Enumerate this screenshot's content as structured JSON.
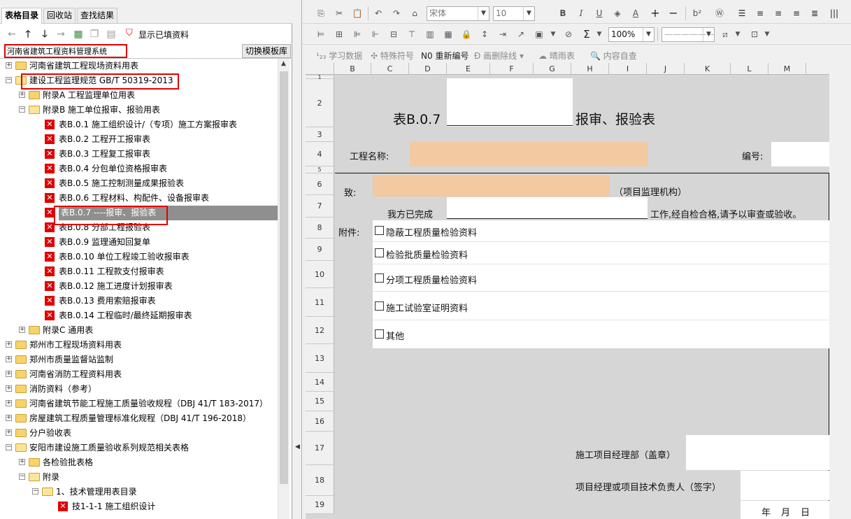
{
  "left_tabs": [
    "表格目录",
    "回收站",
    "查找结果"
  ],
  "toolbar": {
    "show_filled": "显示已填资料"
  },
  "template": {
    "name": "河南省建筑工程资料管理系统",
    "switch_button": "切换模板库"
  },
  "tree": [
    {
      "label": "河南省建筑工程现场资料用表",
      "level": 0,
      "type": "folder",
      "expand": "+"
    },
    {
      "label": "建设工程监理规范 GB/T 50319-2013",
      "level": 0,
      "type": "folder-open",
      "expand": "-"
    },
    {
      "label": "附录A 工程监理单位用表",
      "level": 1,
      "type": "folder",
      "expand": "+"
    },
    {
      "label": "附录B 施工单位报审、报验用表",
      "level": 1,
      "type": "folder-open",
      "expand": "-"
    },
    {
      "label": "表B.0.1 施工组织设计/（专项）施工方案报审表",
      "level": 2,
      "type": "doc"
    },
    {
      "label": "表B.0.2 工程开工报审表",
      "level": 2,
      "type": "doc"
    },
    {
      "label": "表B.0.3 工程复工报审表",
      "level": 2,
      "type": "doc"
    },
    {
      "label": "表B.0.4 分包单位资格报审表",
      "level": 2,
      "type": "doc"
    },
    {
      "label": "表B.0.5 施工控制测量成果报验表",
      "level": 2,
      "type": "doc"
    },
    {
      "label": "表B.0.6 工程材料、构配件、设备报审表",
      "level": 2,
      "type": "doc"
    },
    {
      "label": "表B.0.7 ----报审、报验表",
      "level": 2,
      "type": "doc",
      "selected": true
    },
    {
      "label": "表B.0.8 分部工程报验表",
      "level": 2,
      "type": "doc"
    },
    {
      "label": "表B.0.9 监理通知回复单",
      "level": 2,
      "type": "doc"
    },
    {
      "label": "表B.0.10 单位工程竣工验收报审表",
      "level": 2,
      "type": "doc"
    },
    {
      "label": "表B.0.11 工程款支付报审表",
      "level": 2,
      "type": "doc"
    },
    {
      "label": "表B.0.12 施工进度计划报审表",
      "level": 2,
      "type": "doc"
    },
    {
      "label": "表B.0.13 费用索赔报审表",
      "level": 2,
      "type": "doc"
    },
    {
      "label": "表B.0.14 工程临时/最终延期报审表",
      "level": 2,
      "type": "doc"
    },
    {
      "label": "附录C 通用表",
      "level": 1,
      "type": "folder",
      "expand": "+"
    },
    {
      "label": "郑州市工程现场资料用表",
      "level": 0,
      "type": "folder",
      "expand": "+"
    },
    {
      "label": "郑州市质量监督站监制",
      "level": 0,
      "type": "folder",
      "expand": "+"
    },
    {
      "label": "河南省消防工程资料用表",
      "level": 0,
      "type": "folder",
      "expand": "+"
    },
    {
      "label": "消防资料（参考）",
      "level": 0,
      "type": "folder",
      "expand": "+"
    },
    {
      "label": "河南省建筑节能工程施工质量验收规程（DBJ 41/T 183-2017）",
      "level": 0,
      "type": "folder",
      "expand": "+"
    },
    {
      "label": "房屋建筑工程质量管理标准化规程（DBJ 41/T 196-2018）",
      "level": 0,
      "type": "folder",
      "expand": "+"
    },
    {
      "label": "分户验收表",
      "level": 0,
      "type": "folder",
      "expand": "+"
    },
    {
      "label": "安阳市建设施工质量验收系列规范相关表格",
      "level": 0,
      "type": "folder-open",
      "expand": "-"
    },
    {
      "label": "各检验批表格",
      "level": 1,
      "type": "folder",
      "expand": "+"
    },
    {
      "label": "附录",
      "level": 1,
      "type": "folder-open",
      "expand": "-"
    },
    {
      "label": "1、技术管理用表目录",
      "level": 2,
      "type": "folder-open",
      "expand": "-"
    },
    {
      "label": "技1-1-1 施工组织设计",
      "level": 3,
      "type": "doc"
    }
  ],
  "editor_toolbar": {
    "font_name": "宋体",
    "font_size": "10",
    "zoom": "100%",
    "sigma": "Σ",
    "line_style": "——————"
  },
  "toolbar3": {
    "study": "学习数据",
    "special": "特殊符号",
    "renumber": "重新编号",
    "delete_line": "画删除线",
    "clear": "晴雨表",
    "check": "内容自查"
  },
  "columns": [
    "B",
    "C",
    "D",
    "E",
    "F",
    "G",
    "H",
    "I",
    "J",
    "K",
    "L",
    "M"
  ],
  "rows": [
    "1",
    "2",
    "3",
    "4",
    "5",
    "6",
    "7",
    "8",
    "9",
    "10",
    "11",
    "12",
    "13",
    "14",
    "15",
    "16",
    "17",
    "18",
    "19"
  ],
  "form": {
    "title_prefix": "表B.0.7",
    "title_suffix": "报审、报验表",
    "project_name_label": "工程名称:",
    "number_label": "编号:",
    "to_label": "致:",
    "supervisor_org": "（项目监理机构）",
    "done_label": "我方已完成",
    "done_suffix": "工作,经自检合格,请予以审查或验收。",
    "attachment_label": "附件:",
    "attachments": [
      "隐蔽工程质量检验资料",
      "检验批质量检验资料",
      "分项工程质量检验资料",
      "施工试验室证明资料",
      "其他"
    ],
    "dept_seal": "施工项目经理部（盖章）",
    "manager_sign": "项目经理或项目技术负责人（签字）",
    "year": "年",
    "month": "月",
    "day": "日"
  },
  "colors": {
    "orange_fill": "#f2c9a0",
    "highlight_red": "#e00000",
    "selected_bg": "#8f8f8f"
  }
}
